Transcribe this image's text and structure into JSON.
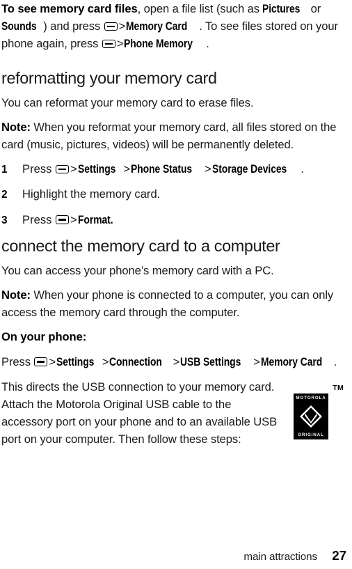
{
  "document": {
    "intro": {
      "lead_bold": "To see memory card files",
      "part1": ", open a file list (such as ",
      "menu_pictures": "Pictures",
      "part2": " or ",
      "menu_sounds": "Sounds",
      "part3": ") and press ",
      "gt": ">",
      "menu_memory_card": "Memory Card",
      "part4": ". To see files stored on your phone again, press ",
      "menu_phone_memory": "Phone Memory",
      "part5": "."
    },
    "section_reformat": {
      "heading": "reformatting your memory card",
      "body": "You can reformat your memory card to erase files.",
      "note_label": "Note:",
      "note_text": " When you reformat your memory card, all files stored on the card (music, pictures, videos) will be permanently deleted.",
      "steps": [
        {
          "number": "1",
          "prefix": "Press ",
          "menu_items": [
            "Settings",
            "Phone Status",
            "Storage Devices"
          ],
          "suffix": "."
        },
        {
          "number": "2",
          "plain": "Highlight the memory card."
        },
        {
          "number": "3",
          "prefix": "Press ",
          "menu_items": [
            "Format."
          ],
          "suffix": ""
        }
      ]
    },
    "section_connect": {
      "heading": "connect the memory card to a computer",
      "body": "You can access your phone’s memory card with a PC.",
      "note_label": "Note:",
      "note_text": " When your phone is connected to a computer, you can only access the memory card through the computer.",
      "subheading": "On your phone:",
      "press_line": {
        "prefix": "Press ",
        "menu_items": [
          "Settings",
          "Connection",
          "USB Settings",
          "Memory Card"
        ],
        "suffix": "."
      },
      "closing_text": "This directs the USB connection to your memory card. Attach the Motorola Original USB cable to the accessory port on your phone and to an available USB port on your computer. Then follow these steps:"
    },
    "logo": {
      "trademark": "TM",
      "brand_top": "MOTOROLA",
      "brand_bottom": "ORIGINAL"
    },
    "footer": {
      "chapter": "main attractions",
      "page_number": "27"
    },
    "icons": {
      "menu_key": "menu-key-icon"
    }
  }
}
